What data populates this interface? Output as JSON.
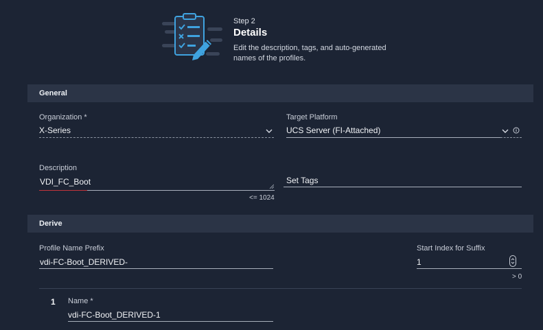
{
  "header": {
    "step": "Step 2",
    "title": "Details",
    "description": "Edit the description, tags, and auto-generated names of the profiles."
  },
  "sections": {
    "general": "General",
    "derive": "Derive"
  },
  "general": {
    "organization": {
      "label": "Organization *",
      "value": "X-Series"
    },
    "target_platform": {
      "label": "Target Platform",
      "value": "UCS Server (FI-Attached)"
    },
    "description": {
      "label": "Description",
      "value": "VDI_FC_Boot",
      "limit_hint": "<= 1024"
    },
    "tags": {
      "placeholder": "Set Tags"
    }
  },
  "derive": {
    "prefix": {
      "label": "Profile Name Prefix",
      "value": "vdi-FC-Boot_DERIVED-"
    },
    "start_index": {
      "label": "Start Index for Suffix",
      "value": "1",
      "hint": "> 0"
    },
    "rows": [
      {
        "index": "1",
        "name_label": "Name *",
        "name_value": "vdi-FC-Boot_DERIVED-1"
      }
    ]
  },
  "colors": {
    "background": "#1c2434",
    "section_bar": "#2b3446",
    "icon_blue": "#3fa3e0",
    "error_underline": "#c4353b"
  },
  "icons": [
    "checklist-icon",
    "pencil-icon",
    "chevron-down-icon",
    "info-icon",
    "stepper-icon"
  ]
}
